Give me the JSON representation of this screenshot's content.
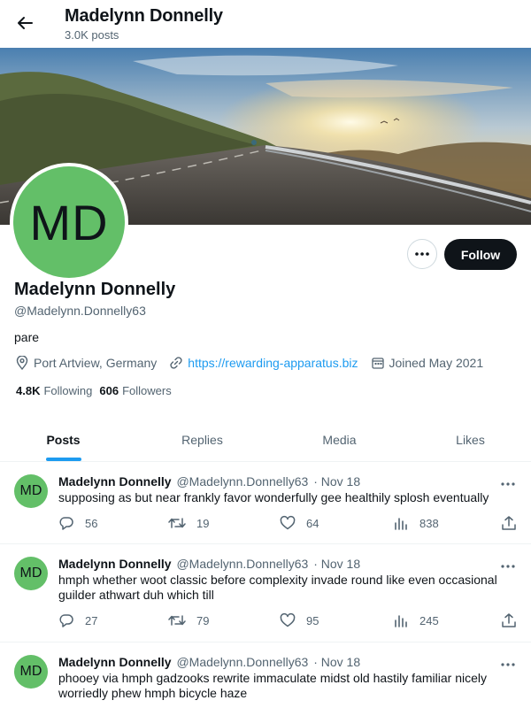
{
  "header": {
    "title": "Madelynn Donnelly",
    "post_count": "3.0K posts"
  },
  "profile": {
    "initials": "MD",
    "display_name": "Madelynn Donnelly",
    "handle": "@Madelynn.Donnelly63",
    "bio": "pare",
    "location": "Port Artview, Germany",
    "website": "https://rewarding-apparatus.biz",
    "joined": "Joined May 2021",
    "following_count": "4.8K",
    "following_label": "Following",
    "followers_count": "606",
    "followers_label": "Followers",
    "avatar_color": "#63bf68"
  },
  "buttons": {
    "follow": "Follow"
  },
  "tabs": [
    {
      "label": "Posts",
      "active": true
    },
    {
      "label": "Replies",
      "active": false
    },
    {
      "label": "Media",
      "active": false
    },
    {
      "label": "Likes",
      "active": false
    }
  ],
  "posts": [
    {
      "initials": "MD",
      "name": "Madelynn Donnelly",
      "handle": "@Madelynn.Donnelly63",
      "date": "· Nov 18",
      "text": "supposing as but near frankly favor wonderfully gee healthily splosh eventually",
      "replies": "56",
      "reposts": "19",
      "likes": "64",
      "views": "838"
    },
    {
      "initials": "MD",
      "name": "Madelynn Donnelly",
      "handle": "@Madelynn.Donnelly63",
      "date": "· Nov 18",
      "text": "hmph whether woot classic before complexity invade round like even occasional guilder athwart duh which till",
      "replies": "27",
      "reposts": "79",
      "likes": "95",
      "views": "245"
    },
    {
      "initials": "MD",
      "name": "Madelynn Donnelly",
      "handle": "@Madelynn.Donnelly63",
      "date": "· Nov 18",
      "text": "phooey via hmph gadzooks rewrite immaculate midst old hastily familiar nicely worriedly phew hmph bicycle haze",
      "replies": "",
      "reposts": "",
      "likes": "",
      "views": ""
    }
  ],
  "colors": {
    "accent": "#1d9bf0",
    "text_primary": "#0f1419",
    "text_secondary": "#536471"
  },
  "icons": [
    "back-arrow-icon",
    "more-icon",
    "location-icon",
    "link-icon",
    "calendar-icon",
    "reply-icon",
    "repost-icon",
    "like-icon",
    "views-icon",
    "share-icon"
  ]
}
